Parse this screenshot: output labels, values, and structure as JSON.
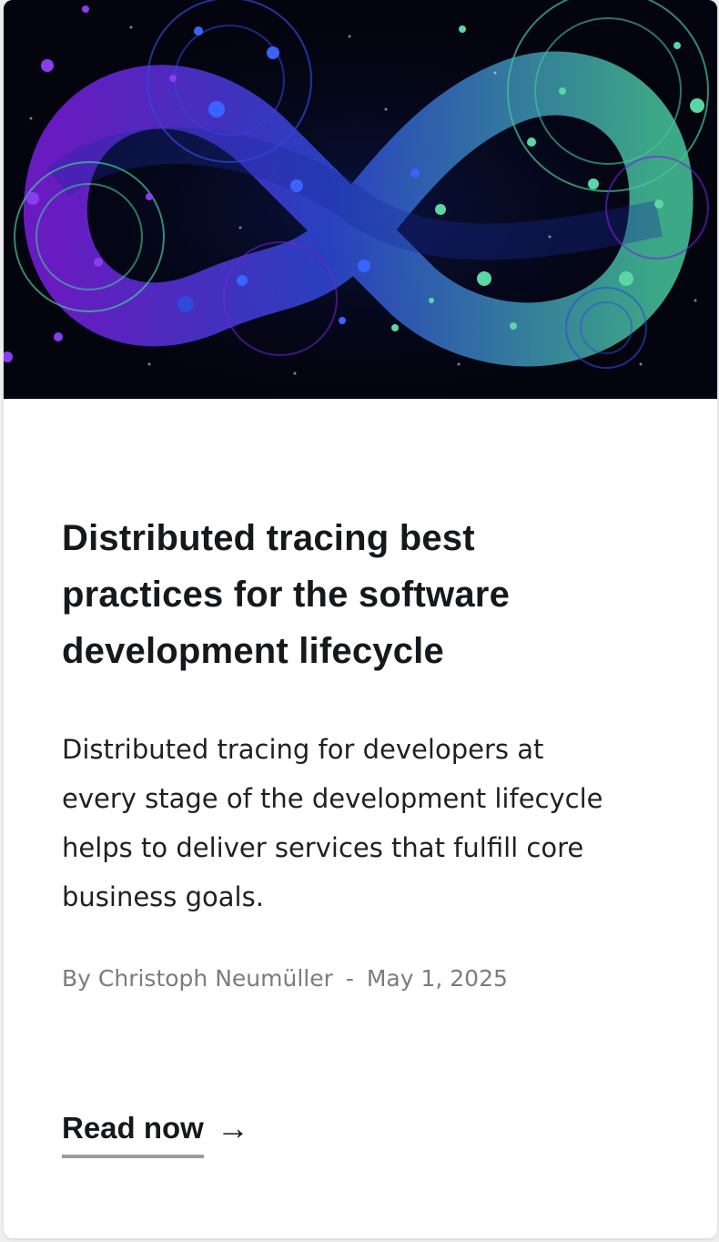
{
  "card": {
    "image": {
      "icon": "infinity-graphic-icon",
      "colors": [
        "#7a1fe0",
        "#2f49d8",
        "#47c59a"
      ]
    },
    "title": "Distributed tracing best practices for the software development lifecycle",
    "excerpt": "Distributed tracing for developers at every stage of the development lifecycle helps to deliver services that fulfill core business goals.",
    "author": "By Christoph Neumüller",
    "separator": "-",
    "date": "May 1, 2025",
    "cta": {
      "label": "Read now",
      "icon": "arrow-right-icon",
      "arrow": "→"
    }
  }
}
